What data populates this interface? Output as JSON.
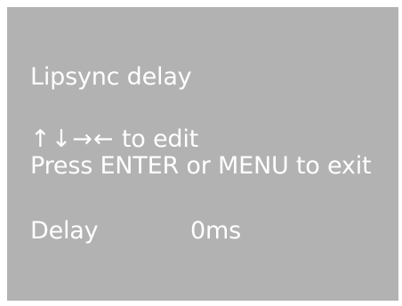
{
  "screen": {
    "title": "Lipsync delay",
    "hint": {
      "arrows": "↑↓→←",
      "text": " to edit"
    },
    "exit_instruction": "Press ENTER or MENU to exit",
    "setting": {
      "label": "Delay",
      "value": "0ms"
    }
  },
  "colors": {
    "panel_background": "#b2b2b2",
    "text": "#ffffff",
    "page_background": "#ffffff"
  }
}
